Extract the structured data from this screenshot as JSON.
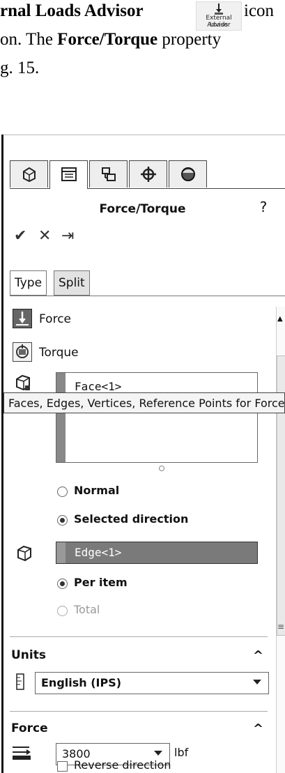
{
  "doc": {
    "line1_bold": "rnal Loads Advisor",
    "line1_rest": "icon",
    "line2_pre": "on.  The ",
    "line2_bold": "Force/Torque",
    "line2_post": " property",
    "line3": "g. 15.",
    "mini_icon_top": "External Loads",
    "mini_icon_bottom": "Advisor"
  },
  "panel": {
    "tabs": [
      "feature-manager-icon",
      "property-manager-icon",
      "configuration-manager-icon",
      "dimxpert-icon",
      "display-manager-icon"
    ],
    "title": "Force/Torque",
    "help": "?",
    "actions": {
      "ok": "✔",
      "cancel": "✕",
      "pin": "⇥"
    },
    "subtabs": {
      "type": "Type",
      "split": "Split"
    },
    "force_label": "Force",
    "torque_label": "Torque",
    "faces_value": "Face<1>",
    "tooltip": "Faces, Edges, Vertices, Reference Points for Force",
    "normal_label": "Normal",
    "selected_direction_label": "Selected direction",
    "edge_value": "Edge<1>",
    "per_item_label": "Per item",
    "total_label": "Total",
    "units": {
      "heading": "Units",
      "value": "English (IPS)"
    },
    "force": {
      "heading": "Force",
      "value": "3800",
      "unit": "lbf",
      "reverse_label": "Reverse direction"
    }
  }
}
